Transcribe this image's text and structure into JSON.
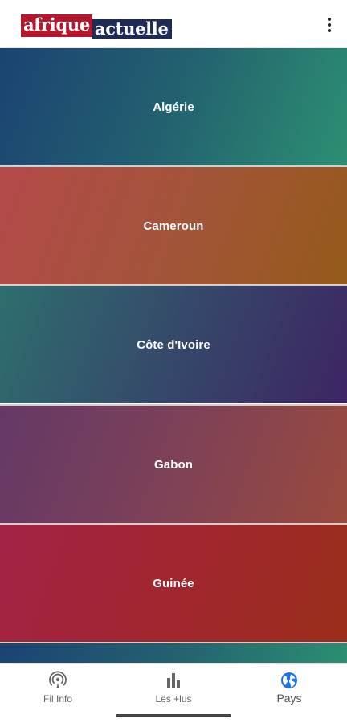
{
  "header": {
    "logo_part1": "afrique",
    "logo_part2": "actuelle",
    "menu_icon": "more-vertical-icon"
  },
  "countries": [
    {
      "label": "Algérie"
    },
    {
      "label": "Cameroun"
    },
    {
      "label": "Côte d'Ivoire"
    },
    {
      "label": "Gabon"
    },
    {
      "label": "Guinée"
    }
  ],
  "bottom_nav": {
    "items": [
      {
        "label": "Fil Info",
        "icon": "podcast-icon",
        "active": false
      },
      {
        "label": "Les +lus",
        "icon": "bar-chart-icon",
        "active": false
      },
      {
        "label": "Pays",
        "icon": "globe-icon",
        "active": true
      }
    ],
    "active_color": "#1a73e8",
    "inactive_color": "#666666"
  },
  "colors": {
    "logo_red": "#b3182d",
    "logo_navy": "#1d2b55"
  }
}
